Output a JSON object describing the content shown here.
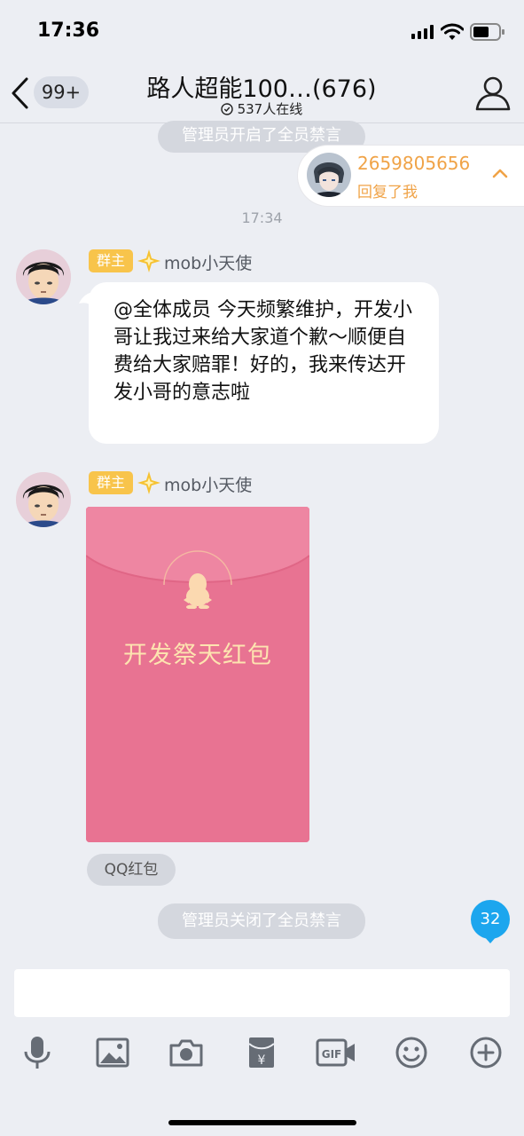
{
  "status_bar": {
    "time": "17:36"
  },
  "header": {
    "unread_count": "99+",
    "title": "路人超能100…(676)",
    "online": "537人在线"
  },
  "system": {
    "mute_on": "管理员开启了全员禁言",
    "mute_off": "管理员关闭了全员禁言"
  },
  "reply_notice": {
    "qq": "2659805656",
    "text": "回复了我"
  },
  "timestamp": "17:34",
  "messages": [
    {
      "role": "群主",
      "sender": "mob小天使",
      "text": "@全体成员 今天频繁维护，开发小哥让我过来给大家道个歉～顺便自费给大家赔罪！好的，我来传达开发小哥的意志啦"
    },
    {
      "role": "群主",
      "sender": "mob小天使",
      "red_packet_title": "开发祭天红包",
      "red_packet_type": "QQ红包"
    }
  ],
  "new_message_count": "32",
  "colors": {
    "accent_blue": "#1ca6ee",
    "red_packet": "#e87392",
    "owner_badge": "#f8c44b",
    "reply_orange": "#f0a347"
  },
  "toolbar_icons": [
    "microphone-icon",
    "image-icon",
    "camera-icon",
    "red-packet-icon",
    "gif-icon",
    "emoji-icon",
    "plus-icon"
  ]
}
